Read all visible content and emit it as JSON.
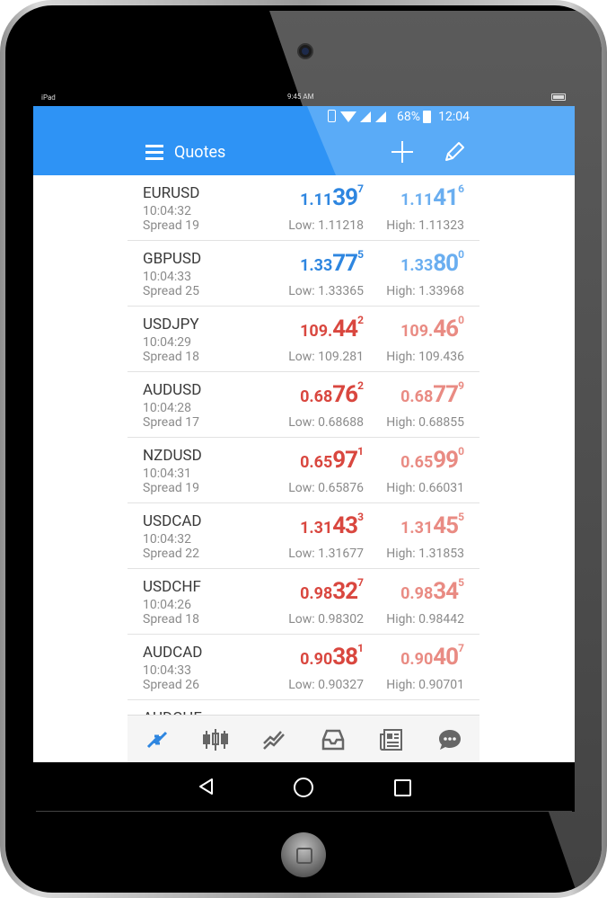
{
  "ipad_status": {
    "carrier": "iPad",
    "time": "9:45 AM"
  },
  "android_status": {
    "battery_percent": "68%",
    "clock": "12:04"
  },
  "header": {
    "title": "Quotes"
  },
  "quotes": [
    {
      "symbol": "EURUSD",
      "time": "10:04:32",
      "spread": "Spread 19",
      "bid": {
        "small": "1.11",
        "big": "39",
        "sup": "7"
      },
      "ask": {
        "small": "1.11",
        "big": "41",
        "sup": "6"
      },
      "low": "Low: 1.11218",
      "high": "High: 1.11323"
    },
    {
      "symbol": "GBPUSD",
      "time": "10:04:33",
      "spread": "Spread 25",
      "bid": {
        "small": "1.33",
        "big": "77",
        "sup": "5"
      },
      "ask": {
        "small": "1.33",
        "big": "80",
        "sup": "0"
      },
      "low": "Low: 1.33365",
      "high": "High: 1.33968"
    },
    {
      "symbol": "USDJPY",
      "time": "10:04:29",
      "spread": "Spread 18",
      "bid": {
        "small": "109.",
        "big": "44",
        "sup": "2"
      },
      "ask": {
        "small": "109.",
        "big": "46",
        "sup": "0"
      },
      "low": "Low: 109.281",
      "high": "High: 109.436"
    },
    {
      "symbol": "AUDUSD",
      "time": "10:04:28",
      "spread": "Spread 17",
      "bid": {
        "small": "0.68",
        "big": "76",
        "sup": "2"
      },
      "ask": {
        "small": "0.68",
        "big": "77",
        "sup": "9"
      },
      "low": "Low: 0.68688",
      "high": "High: 0.68855"
    },
    {
      "symbol": "NZDUSD",
      "time": "10:04:31",
      "spread": "Spread 19",
      "bid": {
        "small": "0.65",
        "big": "97",
        "sup": "1"
      },
      "ask": {
        "small": "0.65",
        "big": "99",
        "sup": "0"
      },
      "low": "Low: 0.65876",
      "high": "High: 0.66031"
    },
    {
      "symbol": "USDCAD",
      "time": "10:04:32",
      "spread": "Spread 22",
      "bid": {
        "small": "1.31",
        "big": "43",
        "sup": "3"
      },
      "ask": {
        "small": "1.31",
        "big": "45",
        "sup": "5"
      },
      "low": "Low: 1.31677",
      "high": "High: 1.31853"
    },
    {
      "symbol": "USDCHF",
      "time": "10:04:26",
      "spread": "Spread 18",
      "bid": {
        "small": "0.98",
        "big": "32",
        "sup": "7"
      },
      "ask": {
        "small": "0.98",
        "big": "34",
        "sup": "5"
      },
      "low": "Low: 0.98302",
      "high": "High: 0.98442"
    },
    {
      "symbol": "AUDCAD",
      "time": "10:04:33",
      "spread": "Spread 26",
      "bid": {
        "small": "0.90",
        "big": "38",
        "sup": "1"
      },
      "ask": {
        "small": "0.90",
        "big": "40",
        "sup": "7"
      },
      "low": "Low: 0.90327",
      "high": "High: 0.90701"
    },
    {
      "symbol": "AUDCHF",
      "time": "",
      "spread": "",
      "bid": {
        "small": "",
        "big": "",
        "sup": ""
      },
      "ask": {
        "small": "",
        "big": "",
        "sup": ""
      },
      "low": "",
      "high": ""
    }
  ],
  "tabbar": [
    "quotes-icon",
    "chart-icon",
    "trade-icon",
    "history-icon",
    "news-icon",
    "messages-icon"
  ],
  "colors": {
    "header": "#2e93f5",
    "header_light": "#5aabf7",
    "up": "#2e86e0",
    "down": "#d9473f"
  }
}
